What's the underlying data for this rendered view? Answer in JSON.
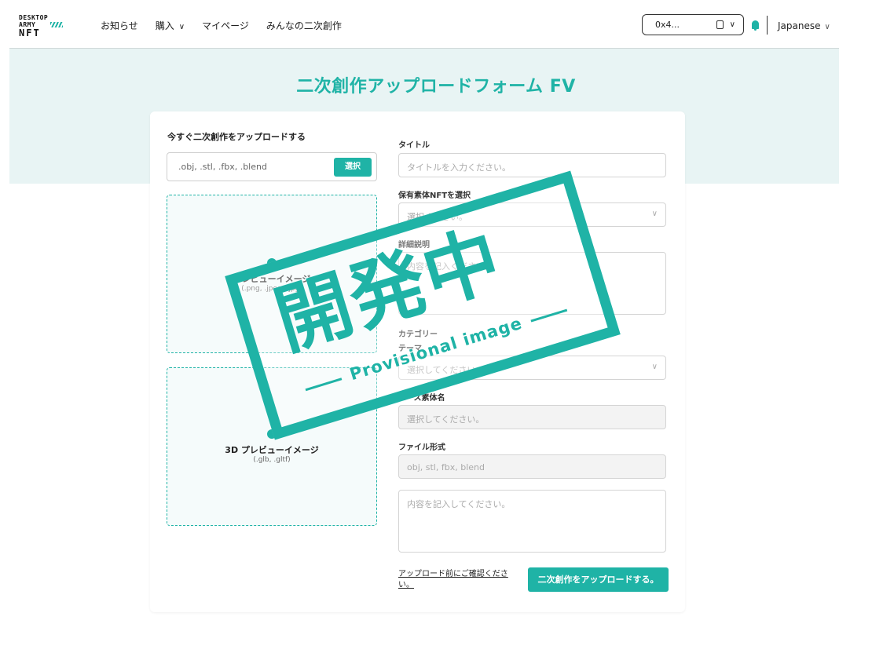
{
  "header": {
    "logo": "DESKTOP ARMY NFT",
    "nav": [
      {
        "label": "お知らせ"
      },
      {
        "label": "購入",
        "chevron": "∨"
      },
      {
        "label": "マイページ"
      },
      {
        "label": "みんなの二次創作"
      }
    ],
    "wallet_address": "0x4...",
    "wallet_chevron": "∨",
    "language": "Japanese",
    "language_chevron": "∨"
  },
  "page": {
    "title": "二次創作アップロードフォーム FV"
  },
  "upload": {
    "heading": "今すぐ二次創作をアップロードする",
    "file_placeholder": ".obj, .stl, .fbx, .blend",
    "select_button": "選択",
    "preview_label": "プレビューイメージ",
    "preview_formats": "(.png, .jpeg, .jpg)",
    "preview3d_label": "3D プレビューイメージ",
    "preview3d_formats": "(.glb, .gltf)"
  },
  "form": {
    "title_label": "タイトル",
    "title_placeholder": "タイトルを入力ください。",
    "nft_label": "保有素体NFTを選択",
    "nft_placeholder": "選択ください。",
    "desc_label": "詳細説明",
    "desc_placeholder": "内容を記入ください。",
    "category_label": "カテゴリー",
    "theme_label": "テーマ",
    "theme_placeholder": "選択してください。",
    "base_label": "ベース素体名",
    "base_placeholder": "選択してください。",
    "format_label": "ファイル形式",
    "format_value": "obj, stl, fbx, blend",
    "notes_placeholder": "内容を記入してください。",
    "confirm_link": "アップロード前にご確認ください。",
    "submit_button": "二次創作をアップロードする。"
  },
  "stamp": {
    "main_text": "開発中",
    "sub_text": "Provisional image",
    "color": "#1fb3a6"
  },
  "colors": {
    "accent": "#1fb3a6",
    "hero_bg": "#e8f4f4"
  }
}
